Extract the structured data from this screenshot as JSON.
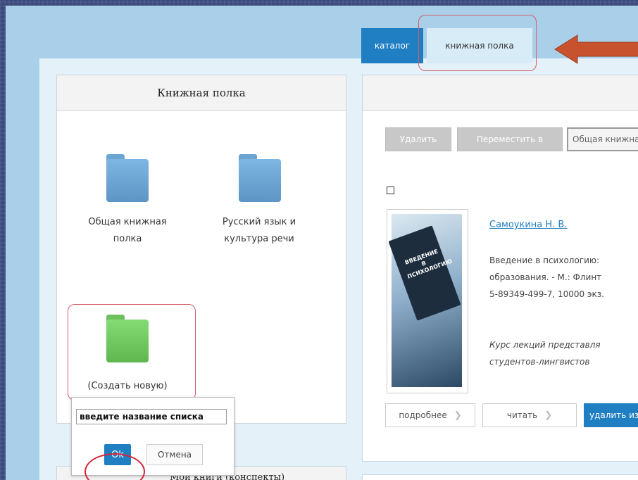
{
  "tabs": {
    "catalog": "каталог",
    "shelf": "книжная полка"
  },
  "shelf_panel": {
    "title": "Книжная полка",
    "folders": [
      {
        "label_line1": "Общая книжная",
        "label_line2": "полка"
      },
      {
        "label_line1": "Русский язык и",
        "label_line2": "культура речи"
      },
      {
        "label_line1": "(Создать новую)",
        "label_line2": ""
      }
    ]
  },
  "new_list_popover": {
    "input_value": "введите название списка",
    "ok_label": "Ok",
    "cancel_label": "Отмена"
  },
  "second_panel": {
    "title": "Мои книги (конспекты)"
  },
  "book_panel": {
    "delete_label": "Удалить",
    "move_label": "Переместить в",
    "shelf_select": "Общая книжная полка",
    "book": {
      "author": "Самоукина Н. В.",
      "cover_title": "ВВЕДЕНИЕ В ПСИХОЛОГИЮ",
      "desc_line1": "Введение в психологию:",
      "desc_line2": "образования. - М.: Флинт",
      "desc_line3": "5-89349-499-7, 10000 экз.",
      "annotation_line1": "Курс лекций представля",
      "annotation_line2": "студентов-лингвистов"
    },
    "details_label": "подробнее",
    "read_label": "читать",
    "remove_label": "удалить из полки"
  },
  "colors": {
    "accent": "#1f7fc2",
    "highlight": "#d45b6a",
    "arrow": "#c8522e"
  }
}
